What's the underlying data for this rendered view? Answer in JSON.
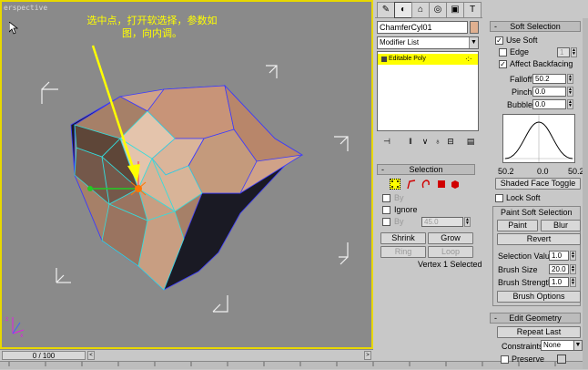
{
  "viewport": {
    "label": "erspective",
    "annotation_line1": "选中点，打开软选择，参数如",
    "annotation_line2": "图，向内调。"
  },
  "timeline": {
    "frame": "0 / 100",
    "left_arrow": "<",
    "right_arrow": ">"
  },
  "tabs": [
    "create-icon",
    "modify-icon",
    "hierarchy-icon",
    "motion-icon",
    "display-icon",
    "utilities-icon"
  ],
  "modify": {
    "object_name": "ChamferCyl01",
    "object_color": "#e0b090",
    "modifier_list": "Modifier List",
    "stack_item": "Editable Poly",
    "stack_dots": "·:·"
  },
  "selection": {
    "title": "Selection",
    "by_label": "By",
    "ignore_label": "Ignore",
    "by_angle_label": "By",
    "by_angle_value": "45.0",
    "shrink": "Shrink",
    "grow": "Grow",
    "ring": "Ring",
    "loop": "Loop",
    "status": "Vertex 1 Selected"
  },
  "soft_selection": {
    "title": "Soft Selection",
    "use_soft": "Use Soft",
    "edge": "Edge",
    "edge_value": "1",
    "affect_backfacing": "Affect Backfacing",
    "falloff_label": "Falloff:",
    "falloff": "50.2",
    "pinch_label": "Pinch:",
    "pinch": "0.0",
    "bubble_label": "Bubble:",
    "bubble": "0.0",
    "curve_left": "50.2",
    "curve_mid": "0.0",
    "curve_right": "50.2",
    "shaded_face_toggle": "Shaded Face Toggle",
    "lock_soft": "Lock Soft",
    "paint_title": "Paint Soft Selection",
    "paint": "Paint",
    "blur": "Blur",
    "revert": "Revert",
    "selection_value_label": "Selection Value",
    "selection_value": "1.0",
    "brush_size_label": "Brush Size",
    "brush_size": "20.0",
    "brush_strength_label": "Brush Strength",
    "brush_strength": "1.0",
    "brush_options": "Brush Options"
  },
  "edit_geometry": {
    "title": "Edit Geometry",
    "repeat_last": "Repeat Last",
    "constraints_label": "Constraints:",
    "constraints_value": "None",
    "preserve": "Preserve"
  }
}
